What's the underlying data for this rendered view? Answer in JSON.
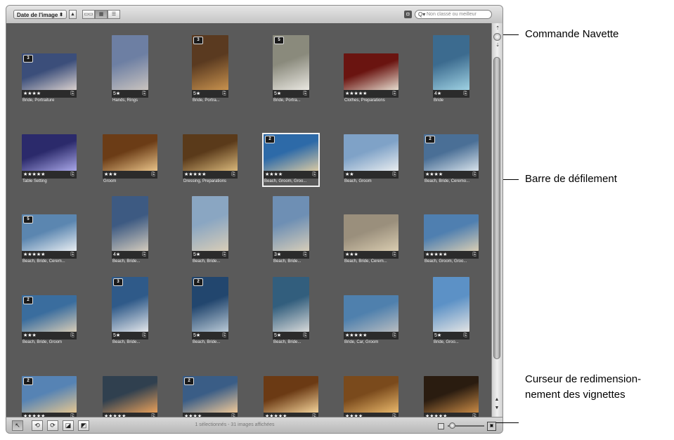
{
  "toolbar": {
    "sort_label": "Date de l'image",
    "sort_arrows": "⬍",
    "order_icon": "▲",
    "view_icons": [
      "▭▭",
      "▦",
      "☰"
    ],
    "filter_icon": "◘",
    "search_placeholder": "Non classé ou meilleur",
    "search_icon": "Q▾"
  },
  "thumbnails": [
    {
      "badge": "3",
      "stars": "★★★★",
      "caption": "Bride, Portraiture",
      "c1": "#3b4e7a",
      "c2": "#d9d0ce"
    },
    {
      "badge": "",
      "stars": "5★",
      "caption": "Hands, Rings",
      "c1": "#6d7fa3",
      "c2": "#c9c3bf"
    },
    {
      "badge": "3",
      "stars": "5★",
      "caption": "Bride, Portra...",
      "c1": "#5a3a20",
      "c2": "#c8924e"
    },
    {
      "badge": "5",
      "stars": "5★",
      "caption": "Bride, Portra...",
      "c1": "#8a8a7c",
      "c2": "#e9e7e1"
    },
    {
      "badge": "",
      "stars": "★★★★★",
      "caption": "Clothes, Preparations",
      "c1": "#6a1410",
      "c2": "#e6dccf"
    },
    {
      "badge": "",
      "stars": "4★",
      "caption": "Bride",
      "c1": "#3c6b8f",
      "c2": "#9fd2e3"
    },
    {
      "badge": "",
      "stars": "★★★★★",
      "caption": "Table Setting",
      "c1": "#2b2a6b",
      "c2": "#a9a7e8"
    },
    {
      "badge": "",
      "stars": "★★★",
      "caption": "Groom",
      "c1": "#6b3c16",
      "c2": "#e9c389"
    },
    {
      "badge": "",
      "stars": "★★★★★",
      "caption": "Dressing, Preparations",
      "c1": "#5a3a1a",
      "c2": "#d8b77a"
    },
    {
      "badge": "2",
      "stars": "★★★★",
      "caption": "Beach, Groom, Groo...",
      "c1": "#2d6aa8",
      "c2": "#d8c9a4"
    },
    {
      "badge": "",
      "stars": "★★",
      "caption": "Beach, Groom",
      "c1": "#7fa2c7",
      "c2": "#e8ecef"
    },
    {
      "badge": "2",
      "stars": "★★★★",
      "caption": "Beach, Bride, Ceremo...",
      "c1": "#4a6f96",
      "c2": "#d7e2ea"
    },
    {
      "badge": "5",
      "stars": "★★★★★",
      "caption": "Beach, Bride, Cerem...",
      "c1": "#5b86b0",
      "c2": "#e9eef2"
    },
    {
      "badge": "",
      "stars": "4★",
      "caption": "Beach, Bride...",
      "c1": "#3d5a82",
      "c2": "#d3cbbd"
    },
    {
      "badge": "",
      "stars": "5★",
      "caption": "Beach, Bride...",
      "c1": "#8aa6c2",
      "c2": "#d8cdb8"
    },
    {
      "badge": "",
      "stars": "3★",
      "caption": "Beach, Bride...",
      "c1": "#6e8fb4",
      "c2": "#d6cdb9"
    },
    {
      "badge": "",
      "stars": "★★★",
      "caption": "Beach, Bride, Cerem...",
      "c1": "#9a8f7c",
      "c2": "#d9ccb0"
    },
    {
      "badge": "",
      "stars": "★★★★★",
      "caption": "Beach, Groom, Groo...",
      "c1": "#4f7fb0",
      "c2": "#d8cdb4"
    },
    {
      "badge": "2",
      "stars": "★★★",
      "caption": "Beach, Bride, Groom",
      "c1": "#3a6d9e",
      "c2": "#d7ccb7"
    },
    {
      "badge": "3",
      "stars": "5★",
      "caption": "Beach, Bride...",
      "c1": "#2f5a89",
      "c2": "#e3e6ea"
    },
    {
      "badge": "2",
      "stars": "5★",
      "caption": "Beach, Bride...",
      "c1": "#22466e",
      "c2": "#b9c9d6"
    },
    {
      "badge": "",
      "stars": "5★",
      "caption": "Beach, Bride...",
      "c1": "#325e7d",
      "c2": "#d7d9d9"
    },
    {
      "badge": "",
      "stars": "★★★★★",
      "caption": "Bride, Car, Groom",
      "c1": "#4f80ad",
      "c2": "#b8bcc0"
    },
    {
      "badge": "",
      "stars": "5★",
      "caption": "Bride, Groo...",
      "c1": "#5c91c6",
      "c2": "#e2e3e3"
    },
    {
      "badge": "2",
      "stars": "★★★★★",
      "caption": "",
      "c1": "#5683b4",
      "c2": "#e4c691"
    },
    {
      "badge": "",
      "stars": "★★★★★",
      "caption": "",
      "c1": "#30404f",
      "c2": "#e8a05a"
    },
    {
      "badge": "2",
      "stars": "★★★★",
      "caption": "",
      "c1": "#3a5d86",
      "c2": "#f0c998"
    },
    {
      "badge": "",
      "stars": "★★★★★",
      "caption": "",
      "c1": "#6b3a14",
      "c2": "#f4d39a"
    },
    {
      "badge": "",
      "stars": "★★★★",
      "caption": "",
      "c1": "#7a4a1c",
      "c2": "#e9b86b"
    },
    {
      "badge": "",
      "stars": "★★★★★",
      "caption": "",
      "c1": "#2a1c10",
      "c2": "#c88a45"
    }
  ],
  "scrollbar": {
    "up": "▲",
    "down": "▼"
  },
  "bottombar": {
    "tools": [
      "↖",
      "⟲",
      "⟳",
      "◪",
      "◩"
    ],
    "status": "1 sélectionnés - 31 images affichées",
    "large_icon": "▣"
  },
  "callouts": {
    "shuttle": "Commande Navette",
    "scrollbar": "Barre de défilement",
    "resize": "Curseur de redimension-\nnement des vignettes"
  }
}
